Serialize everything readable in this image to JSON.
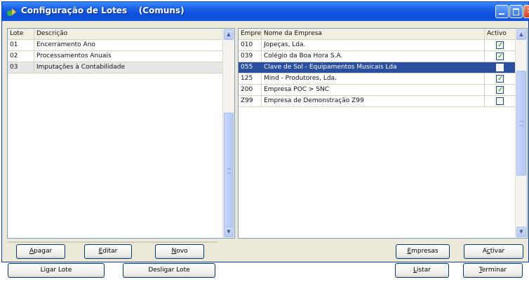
{
  "window": {
    "title": "Configuração de Lotes    (Comuns)",
    "colors": {
      "titlebar": "#0b4ed8",
      "selection": "#2a4f9e",
      "check": "#21a121"
    }
  },
  "lotes": {
    "headers": [
      "Lote",
      "Descrição"
    ],
    "rows": [
      {
        "lote": "01",
        "descricao": "Encerramento Ano"
      },
      {
        "lote": "02",
        "descricao": "Processamentos Anuais"
      },
      {
        "lote": "03",
        "descricao": "Imputações à Contabilidade"
      }
    ],
    "selected_index": 2
  },
  "empresas": {
    "headers": [
      "Empresa",
      "Nome da Empresa",
      "Activo"
    ],
    "rows": [
      {
        "codigo": "010",
        "nome": "Jopeças, Lda.",
        "activo": true
      },
      {
        "codigo": "039",
        "nome": "Colégio da Boa Hora S.A.",
        "activo": true
      },
      {
        "codigo": "055",
        "nome": "Clave de Sol - Equipamentos Musicais Lda",
        "activo": false
      },
      {
        "codigo": "125",
        "nome": "Mind - Produtores, Lda.",
        "activo": true
      },
      {
        "codigo": "200",
        "nome": "Empresa POC > SNC",
        "activo": true
      },
      {
        "codigo": "Z99",
        "nome": "Empresa de Demonstração Z99",
        "activo": false
      }
    ],
    "selected_index": 2
  },
  "buttons": {
    "apagar": {
      "pre": "",
      "u": "A",
      "post": "pagar"
    },
    "editar": {
      "pre": "",
      "u": "E",
      "post": "ditar"
    },
    "novo": {
      "pre": "",
      "u": "N",
      "post": "ovo"
    },
    "ligar_lote": "Ligar Lote",
    "desligar_lote": "Desligar Lote",
    "empresas": {
      "pre": "",
      "u": "E",
      "post": "mpresas"
    },
    "activar": {
      "pre": "A",
      "u": "c",
      "post": "tivar"
    },
    "listar": {
      "pre": "",
      "u": "L",
      "post": "istar"
    },
    "terminar": {
      "pre": "",
      "u": "T",
      "post": "erminar"
    }
  },
  "icons": {
    "window_icon": "lotes-icon",
    "scroll_up": "scroll-up-icon",
    "scroll_down": "scroll-down-icon"
  }
}
